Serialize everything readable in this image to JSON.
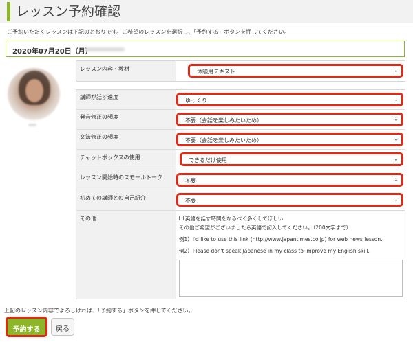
{
  "page": {
    "title": "レッスン予約確認",
    "intro": "ご予約いただくレッスンは下記のとおりです。ご希望のレッスンを選択し、「予約する」ボタンを押してください。",
    "date": "2020年07月20日（月）"
  },
  "lesson": {
    "label": "レッスン内容・教材",
    "value": "体験用テキスト"
  },
  "options": [
    {
      "label": "講師が話す速度",
      "value": "ゆっくり"
    },
    {
      "label": "発音修正の頻度",
      "value": "不要（会話を楽しみたいため）"
    },
    {
      "label": "文法修正の頻度",
      "value": "不要（会話を楽しみたいため）"
    },
    {
      "label": "チャットボックスの使用",
      "value": "できるだけ使用"
    },
    {
      "label": "レッスン開始時のスモールトーク",
      "value": "不要"
    },
    {
      "label": "初めての講師との自己紹介",
      "value": "不要"
    }
  ],
  "other": {
    "label": "その他",
    "checkbox_label": "英語を話す時間をなるべく多くしてほしい",
    "note": "その他ご希望がございましたら英語で記入してください。（200文字まで）",
    "example1": "例1）I'd like to use this link (http://www.japantimes.co.jp) for web news lesson.",
    "example2": "例2）Please don't speak Japanese in my class to improve my English skill."
  },
  "footer": {
    "confirm_text": "上記のレッスン内容でよろしければ、「予約する」ボタンを押してください。",
    "reserve_label": "予約する",
    "back_label": "戻る"
  },
  "colors": {
    "accent_green": "#8db52a",
    "highlight_red": "#e02a18"
  }
}
